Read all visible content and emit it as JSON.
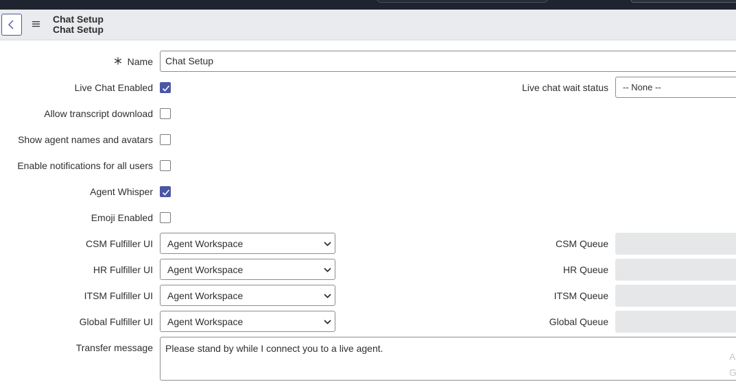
{
  "header": {
    "title": "Chat Setup",
    "subtitle": "Chat Setup",
    "back_icon": "chevron-left-icon",
    "menu_icon": "hamburger-menu-icon"
  },
  "form": {
    "name": {
      "label": "Name",
      "value": "Chat Setup",
      "required": true
    },
    "live_chat_enabled": {
      "label": "Live Chat Enabled",
      "checked": true
    },
    "live_chat_wait_status": {
      "label": "Live chat wait status",
      "value": "-- None --"
    },
    "allow_transcript_download": {
      "label": "Allow transcript download",
      "checked": false
    },
    "show_agent_names": {
      "label": "Show agent names and avatars",
      "checked": false
    },
    "enable_notifications": {
      "label": "Enable notifications for all users",
      "checked": false
    },
    "agent_whisper": {
      "label": "Agent Whisper",
      "checked": true
    },
    "emoji_enabled": {
      "label": "Emoji Enabled",
      "checked": false
    },
    "csm_fulfiller_ui": {
      "label": "CSM Fulfiller UI",
      "value": "Agent Workspace"
    },
    "hr_fulfiller_ui": {
      "label": "HR Fulfiller UI",
      "value": "Agent Workspace"
    },
    "itsm_fulfiller_ui": {
      "label": "ITSM Fulfiller UI",
      "value": "Agent Workspace"
    },
    "global_fulfiller_ui": {
      "label": "Global Fulfiller UI",
      "value": "Agent Workspace"
    },
    "csm_queue": {
      "label": "CSM Queue",
      "value": ""
    },
    "hr_queue": {
      "label": "HR Queue",
      "value": ""
    },
    "itsm_queue": {
      "label": "ITSM Queue",
      "value": ""
    },
    "global_queue": {
      "label": "Global Queue",
      "value": ""
    },
    "transfer_message": {
      "label": "Transfer message",
      "value": "Please stand by while I connect you to a live agent."
    }
  },
  "watermark": {
    "line1": "A",
    "line2": "G"
  },
  "colors": {
    "accent": "#4a56a6",
    "header_bg": "#eaebee",
    "topbar": "#1f2430"
  }
}
